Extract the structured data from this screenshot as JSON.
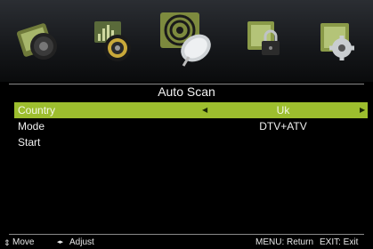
{
  "icons": [
    {
      "name": "picture-icon"
    },
    {
      "name": "sound-icon"
    },
    {
      "name": "channel-icon",
      "active": true
    },
    {
      "name": "lock-icon"
    },
    {
      "name": "setup-icon"
    }
  ],
  "section": {
    "title": "Auto Scan"
  },
  "options": {
    "country": {
      "label": "Country",
      "value": "Uk"
    },
    "mode": {
      "label": "Mode",
      "value": "DTV+ATV"
    },
    "start": {
      "label": "Start"
    }
  },
  "footer": {
    "move_icon": "⇕",
    "move": "Move",
    "adjust_icon": "◂▸",
    "adjust": "Adjust",
    "return": "MENU: Return",
    "exit": "EXIT: Exit"
  },
  "colors": {
    "highlight": "#9dbe2e",
    "background": "#000000"
  }
}
